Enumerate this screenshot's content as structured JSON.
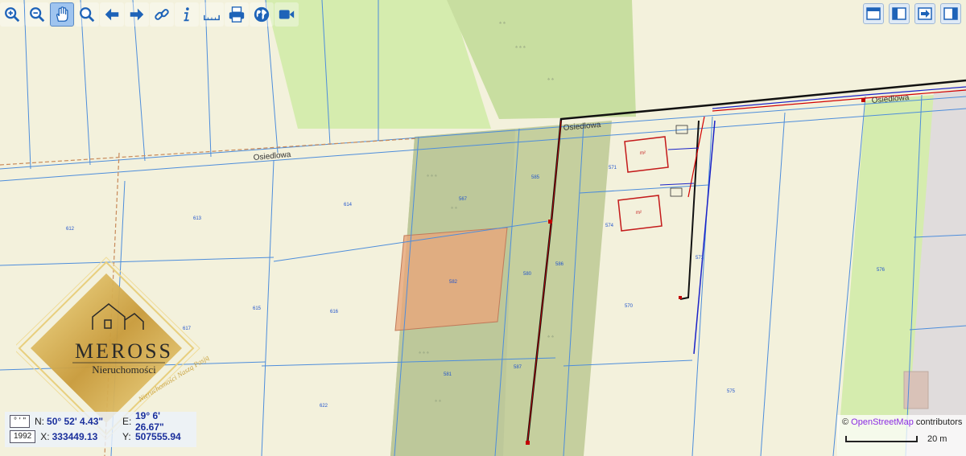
{
  "toolbar": {
    "tools": [
      {
        "name": "zoom-in",
        "icon": "zoom-in-icon"
      },
      {
        "name": "zoom-out",
        "icon": "zoom-out-icon"
      },
      {
        "name": "pan",
        "icon": "hand-icon",
        "active": true
      },
      {
        "name": "zoom-box",
        "icon": "magnifier-icon"
      },
      {
        "name": "back",
        "icon": "arrow-left-icon"
      },
      {
        "name": "forward",
        "icon": "arrow-right-icon"
      },
      {
        "name": "link",
        "icon": "link-icon"
      },
      {
        "name": "info",
        "icon": "info-icon"
      },
      {
        "name": "measure",
        "icon": "ruler-icon"
      },
      {
        "name": "print",
        "icon": "printer-icon"
      },
      {
        "name": "globe",
        "icon": "globe-icon"
      },
      {
        "name": "video",
        "icon": "video-camera-icon"
      }
    ],
    "right_tools": [
      {
        "name": "layout-full",
        "icon": "window-icon"
      },
      {
        "name": "layout-split",
        "icon": "panel-icon"
      },
      {
        "name": "export",
        "icon": "export-icon"
      },
      {
        "name": "side-panel",
        "icon": "sidebar-icon"
      }
    ]
  },
  "map": {
    "street_labels": [
      "Osiedlowa",
      "Osiedlowa",
      "Osiedlowa"
    ],
    "parcel_numbers": [
      "612",
      "613",
      "614",
      "567",
      "585",
      "582",
      "580",
      "571",
      "574",
      "570",
      "573",
      "575",
      "576",
      "586",
      "615",
      "616",
      "617",
      "622",
      "581",
      "587"
    ],
    "building_labels": [
      "m²",
      "m²"
    ],
    "colors": {
      "parcel_line": "#4d8ddb",
      "meadow": "#d5ecae",
      "forest": "#c5cf9e",
      "highlight": "#e8a67a",
      "gas_line": "#d40000",
      "water_line": "#1a22c8",
      "power_line": "#111111",
      "built_up": "#e0dcdc",
      "background": "#f3f1dc"
    }
  },
  "coords": {
    "format_label": "° ' \"",
    "n_label": "N:",
    "n_value": "50° 52' 4.43\"",
    "e_label": "E:",
    "e_value": "19° 6' 26.67\"",
    "crs_label": "1992",
    "x_label": "X:",
    "x_value": "333449.13",
    "y_label": "Y:",
    "y_value": "507555.94"
  },
  "attribution": {
    "copyright": "©",
    "osm_link": "OpenStreetMap",
    "suffix": " contributors",
    "scale_label": "20 m"
  },
  "logo": {
    "name": "MEROSS",
    "subtitle": "Nieruchomości",
    "motto": "Nieruchomości Naszą Pasją"
  }
}
